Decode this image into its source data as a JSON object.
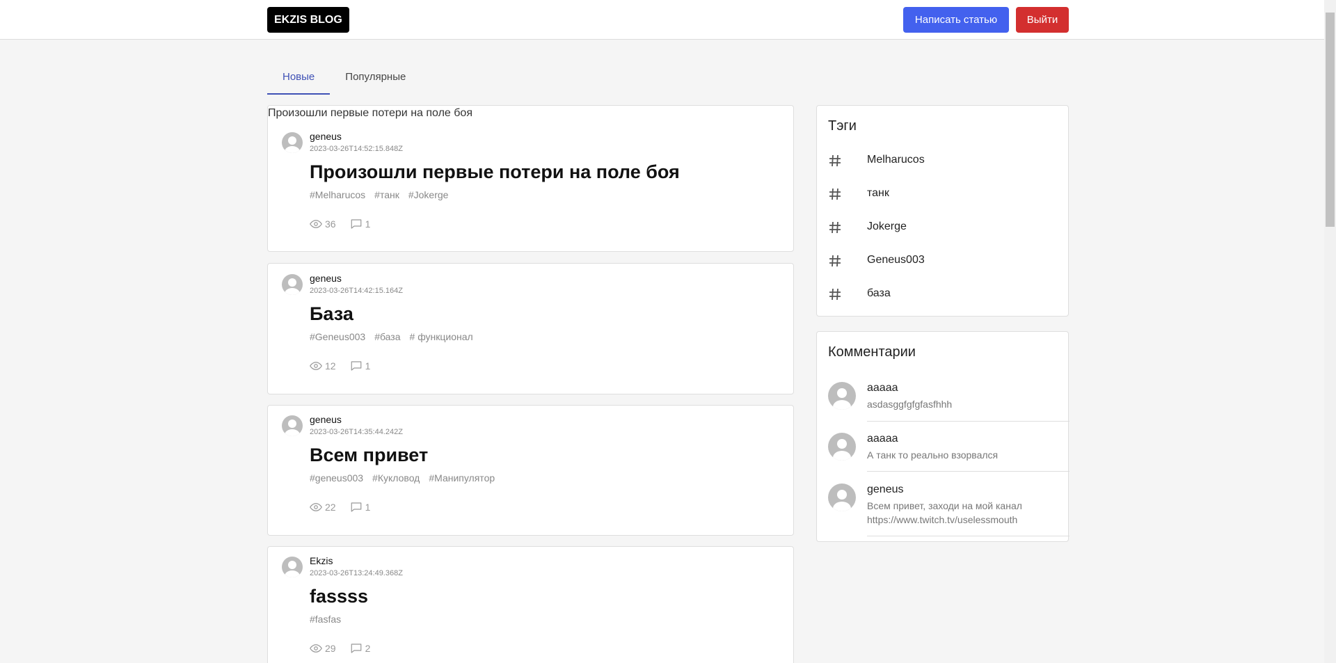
{
  "header": {
    "logo": "EKZIS BLOG",
    "write_button": "Написать статью",
    "logout_button": "Выйти"
  },
  "tabs": [
    {
      "label": "Новые",
      "active": true
    },
    {
      "label": "Популярные",
      "active": false
    }
  ],
  "posts": [
    {
      "image_alt": "Произошли первые потери на поле боя",
      "author": "geneus",
      "date": "2023-03-26T14:52:15.848Z",
      "title": "Произошли первые потери на поле боя",
      "tags": [
        "#Melharucos",
        "#танк",
        "#Jokerge"
      ],
      "views": "36",
      "comments": "1"
    },
    {
      "author": "geneus",
      "date": "2023-03-26T14:42:15.164Z",
      "title": "База",
      "tags": [
        "#Geneus003",
        "#база",
        "# функционал"
      ],
      "views": "12",
      "comments": "1"
    },
    {
      "author": "geneus",
      "date": "2023-03-26T14:35:44.242Z",
      "title": "Всем привет",
      "tags": [
        "#geneus003",
        "#Кукловод",
        "#Манипулятор"
      ],
      "views": "22",
      "comments": "1"
    },
    {
      "author": "Ekzis",
      "date": "2023-03-26T13:24:49.368Z",
      "title": "fassss",
      "tags": [
        "#fasfas"
      ],
      "views": "29",
      "comments": "2"
    }
  ],
  "tags_block": {
    "title": "Тэги",
    "items": [
      "Melharucos",
      "танк",
      "Jokerge",
      "Geneus003",
      "база"
    ]
  },
  "comments_block": {
    "title": "Комментарии",
    "items": [
      {
        "name": "aaaaa",
        "text": "asdasggfgfgfasfhhh"
      },
      {
        "name": "aaaaa",
        "text": "А танк то реально взорвался"
      },
      {
        "name": "geneus",
        "text": "Всем привет, заходи на мой канал https://www.twitch.tv/uselessmouth"
      }
    ]
  },
  "colors": {
    "accent": "#3f51b5",
    "write_button": "#4361ee",
    "logout_button": "#d32f2f"
  }
}
